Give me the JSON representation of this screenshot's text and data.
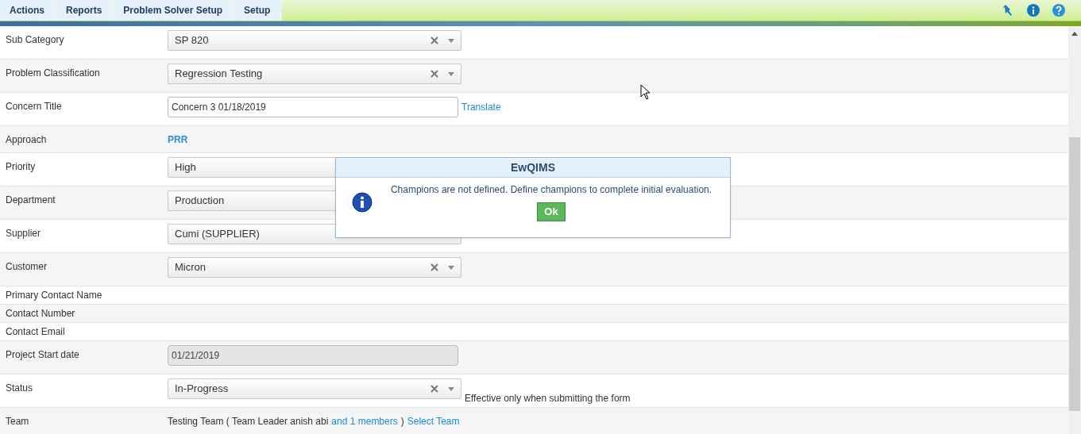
{
  "menu": [
    {
      "label": "Actions"
    },
    {
      "label": "Reports"
    },
    {
      "label": "Problem Solver Setup"
    },
    {
      "label": "Setup"
    }
  ],
  "form": [
    {
      "kind": "select",
      "label": "Sub Category",
      "value": "SP 820"
    },
    {
      "kind": "select",
      "label": "Problem Classification",
      "value": "Regression Testing"
    },
    {
      "kind": "text",
      "label": "Concern Title",
      "value": "Concern 3 01/18/2019",
      "link": "Translate"
    },
    {
      "kind": "link",
      "label": "Approach",
      "value": "PRR"
    },
    {
      "kind": "select_covered",
      "label": "Priority",
      "value": "High"
    },
    {
      "kind": "select_covered",
      "label": "Department",
      "value": "Production"
    },
    {
      "kind": "select_covered",
      "label": "Supplier",
      "value": "Cumi (SUPPLIER)"
    },
    {
      "kind": "select",
      "label": "Customer",
      "value": "Micron"
    },
    {
      "kind": "plain",
      "label": "Primary Contact Name"
    },
    {
      "kind": "plain",
      "label": "Contact Number"
    },
    {
      "kind": "plain",
      "label": "Contact Email"
    },
    {
      "kind": "date",
      "label": "Project Start date",
      "value": "01/21/2019",
      "disabled": true
    },
    {
      "kind": "select",
      "label": "Status",
      "value": "In-Progress",
      "note": "Effective only when submitting the form"
    },
    {
      "kind": "team",
      "label": "Team",
      "text": "Testing Team ( Team Leader anish abi",
      "members": "and 1 members",
      "close": ")",
      "link": "Select Team"
    }
  ],
  "dialog": {
    "title": "EwQIMS",
    "message": "Champions are not defined. Define champions to complete initial evaluation.",
    "button": "Ok"
  }
}
